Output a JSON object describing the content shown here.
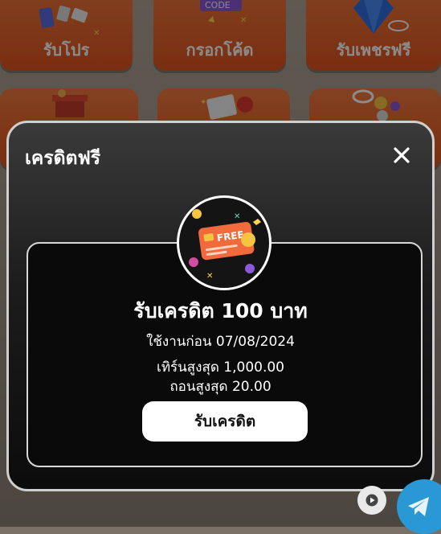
{
  "background_tiles": [
    {
      "label": "รับโปร",
      "icon": "gift-card-icon"
    },
    {
      "label": "กรอกโค้ด",
      "icon": "code-ticket-icon",
      "art_text": "CODE"
    },
    {
      "label": "รับเพชรฟรี",
      "icon": "diamond-icon"
    },
    {
      "label": "",
      "icon": "gift-box-icon"
    },
    {
      "label": "",
      "icon": "calendar-icon"
    },
    {
      "label": "",
      "icon": "coins-icon"
    }
  ],
  "modal": {
    "title": "เครดิตฟรี",
    "close_icon": "close-icon",
    "badge_icon": "free-credit-card-icon",
    "badge_text": "FREE",
    "amount_text": "รับเครดิต 100 บาท",
    "expiry_text": "ใช้งานก่อน 07/08/2024",
    "turnover_text": "เทิร์นสูงสุด 1,000.00",
    "withdraw_text": "ถอนสูงสุด 20.00",
    "claim_button": "รับเครดิต"
  },
  "floating": {
    "play_icon": "play-icon",
    "telegram_icon": "telegram-icon"
  },
  "colors": {
    "tile": "#e0541f",
    "modal_bg": "#1c1c1c",
    "button_bg": "#ffffff",
    "telegram": "#2a98d5"
  }
}
